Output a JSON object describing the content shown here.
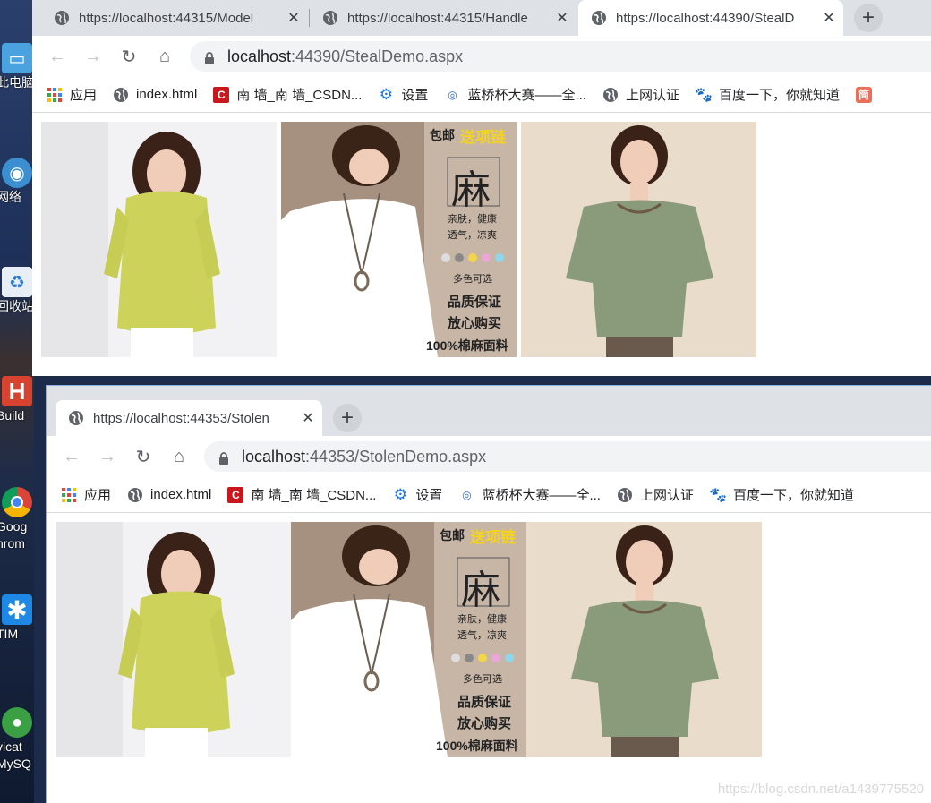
{
  "desktop": {
    "icons": [
      {
        "label": "此电脑",
        "icon": "computer-icon"
      },
      {
        "label": "网络",
        "icon": "network-icon"
      },
      {
        "label": "回收站",
        "icon": "recycle-bin-icon"
      },
      {
        "label": "Build",
        "icon": "hbuilder-icon"
      },
      {
        "label": "Goog",
        "label2": "hrom",
        "icon": "chrome-icon"
      },
      {
        "label": "TIM",
        "icon": "tim-icon"
      },
      {
        "label": "vicat",
        "label2": "MySQ",
        "icon": "navicat-icon"
      }
    ]
  },
  "window1": {
    "tabs": [
      {
        "title": "https://localhost:44315/Model",
        "close": "✕"
      },
      {
        "title": "https://localhost:44315/Handle",
        "close": "✕"
      },
      {
        "title": "https://localhost:44390/StealD",
        "close": "✕"
      }
    ],
    "new_tab": "+",
    "url_host": "localhost",
    "url_path": ":44390/StealDemo.aspx"
  },
  "window2": {
    "tabs": [
      {
        "title": "https://localhost:44353/Stolen",
        "close": "✕"
      }
    ],
    "new_tab": "+",
    "url_host": "localhost",
    "url_path": ":44353/StolenDemo.aspx"
  },
  "bookmarks": [
    {
      "label": "应用",
      "icon": "apps-grid-icon"
    },
    {
      "label": "index.html",
      "icon": "globe-icon"
    },
    {
      "label": "南 墙_南 墙_CSDN...",
      "icon": "csdn-icon"
    },
    {
      "label": "设置",
      "icon": "gear-icon"
    },
    {
      "label": "蓝桥杯大赛——全...",
      "icon": "lanqiao-icon"
    },
    {
      "label": "上网认证",
      "icon": "globe-icon"
    },
    {
      "label": "百度一下，你就知道",
      "icon": "baidu-icon"
    },
    {
      "label": "简",
      "icon": "jianshu-icon"
    }
  ],
  "product_images": {
    "captions": {
      "free_shipping": "包邮",
      "gift": "送项链",
      "material": "麻",
      "desc1": "亲肤，健康",
      "desc2": "透气，凉爽",
      "colors": "多色可选",
      "quality": "品质保证",
      "trust": "放心购买",
      "fabric": "100%棉麻面料"
    }
  },
  "watermark": "https://blog.csdn.net/a1439775520",
  "colors": {
    "tabstrip": "#dee1e6",
    "omnibox": "#f1f3f4",
    "gift_text": "#f5d31e"
  }
}
